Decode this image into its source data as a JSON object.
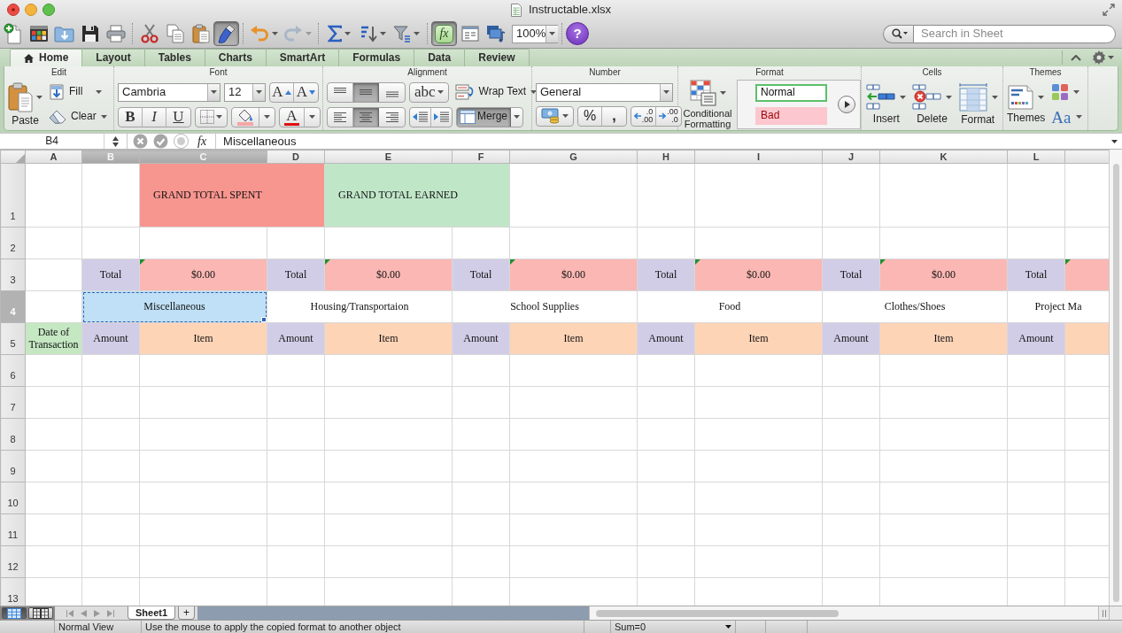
{
  "window": {
    "title": "Instructable.xlsx"
  },
  "toolbar": {
    "redo": {
      "disabled": true
    },
    "format_painter": {
      "pressed": true
    },
    "formula_builder": {
      "label": "fx",
      "pressed": true
    },
    "zoom": "100%",
    "help": "?",
    "search": {
      "placeholder": "Search in Sheet"
    }
  },
  "ribbon": {
    "tabs": [
      {
        "label": "Home",
        "selected": true
      },
      {
        "label": "Layout",
        "selected": false
      },
      {
        "label": "Tables",
        "selected": false
      },
      {
        "label": "Charts",
        "selected": false
      },
      {
        "label": "SmartArt",
        "selected": false
      },
      {
        "label": "Formulas",
        "selected": false
      },
      {
        "label": "Data",
        "selected": false
      },
      {
        "label": "Review",
        "selected": false
      }
    ],
    "edit": {
      "title": "Edit",
      "paste": "Paste",
      "fill": "Fill",
      "clear": "Clear"
    },
    "font": {
      "title": "Font",
      "name": "Cambria",
      "size": "12",
      "grow": "A",
      "shrink": "A",
      "bold": "B",
      "italic": "I",
      "underline": "U",
      "font_color": "A"
    },
    "alignment": {
      "title": "Alignment",
      "vertical": [
        {
          "selected": false
        },
        {
          "selected": true
        },
        {
          "selected": false
        }
      ],
      "orientation": "abc",
      "wrap_text": {
        "label": "Wrap Text",
        "pressed": false
      },
      "horizontal": [
        {
          "selected": false
        },
        {
          "selected": true
        },
        {
          "selected": false
        }
      ],
      "merge": {
        "label": "Merge",
        "pressed": true
      }
    },
    "number": {
      "title": "Number",
      "format": "General",
      "percent": "%",
      "comma": ",",
      "decimals": [
        {
          "top": ".0",
          "bottom": ".00"
        },
        {
          "top": ".00",
          "bottom": ".0"
        }
      ]
    },
    "format": {
      "title": "Format",
      "conditional": "Conditional Formatting",
      "styles": [
        {
          "label": "Normal",
          "kind": "normal",
          "selected": true
        },
        {
          "label": "Bad",
          "kind": "bad",
          "selected": false
        }
      ]
    },
    "cells": {
      "title": "Cells",
      "insert": "Insert",
      "delete": "Delete",
      "format": "Format"
    },
    "themes": {
      "title": "Themes",
      "themes": "Themes",
      "fonts": "Aa"
    }
  },
  "formula_bar": {
    "name_box": "B4",
    "function": "fx",
    "content": "Miscellaneous"
  },
  "grid": {
    "columns": [
      {
        "label": "A",
        "selected": false
      },
      {
        "label": "B",
        "selected": true
      },
      {
        "label": "C",
        "selected": true
      },
      {
        "label": "D",
        "selected": false
      },
      {
        "label": "E",
        "selected": false
      },
      {
        "label": "F",
        "selected": false
      },
      {
        "label": "G",
        "selected": false
      },
      {
        "label": "H",
        "selected": false
      },
      {
        "label": "I",
        "selected": false
      },
      {
        "label": "J",
        "selected": false
      },
      {
        "label": "K",
        "selected": false
      },
      {
        "label": "L",
        "selected": false
      },
      {
        "selected": false
      }
    ],
    "rows": [
      {
        "header": "1",
        "selected": false,
        "cells": [
          {},
          {},
          {
            "text": "GRAND TOTAL SPENT",
            "merged": true,
            "color": "#f7958f"
          },
          {
            "text": "GRAND TOTAL EARNED",
            "merged": true,
            "color": "#c0e6c8"
          },
          {},
          {},
          {},
          {},
          {},
          {},
          {}
        ]
      },
      {
        "header": "2",
        "selected": false
      },
      {
        "header": "3",
        "selected": false,
        "cells": [
          {},
          {
            "text": "Total",
            "color": "#d2cde7"
          },
          {
            "text": "$0.00",
            "color": "#fbb7b3",
            "flagged": true
          },
          {
            "text": "Total",
            "color": "#d2cde7"
          },
          {
            "text": "$0.00",
            "color": "#fbb7b3",
            "flagged": true
          },
          {
            "text": "Total",
            "color": "#d2cde7"
          },
          {
            "text": "$0.00",
            "color": "#fbb7b3",
            "flagged": true
          },
          {
            "text": "Total",
            "color": "#d2cde7"
          },
          {
            "text": "$0.00",
            "color": "#fbb7b3",
            "flagged": true
          },
          {
            "text": "Total",
            "color": "#d2cde7"
          },
          {
            "text": "$0.00",
            "color": "#fbb7b3",
            "flagged": true
          },
          {
            "text": "Total",
            "color": "#d2cde7"
          },
          {
            "color": "#fbb7b3",
            "flagged": true
          }
        ]
      },
      {
        "header": "4",
        "selected": true,
        "cells": [
          {},
          {
            "text": "Miscellaneous",
            "merged": true,
            "color": "#bfe0f6"
          },
          {
            "text": "Housing/Transportaion",
            "merged": true
          },
          {
            "text": "School Supplies",
            "merged": true
          },
          {
            "text": "Food",
            "merged": true
          },
          {
            "text": "Clothes/Shoes",
            "merged": true
          },
          {
            "text": "Project Ma",
            "merged": true
          }
        ]
      },
      {
        "header": "5",
        "selected": false,
        "cells": [
          {
            "text": "Date of Transaction",
            "color": "#c5e8c3"
          },
          {
            "text": "Amount",
            "color": "#d2cde7"
          },
          {
            "text": "Item",
            "color": "#fed4b7"
          },
          {
            "text": "Amount",
            "color": "#d2cde7"
          },
          {
            "text": "Item",
            "color": "#fed4b7"
          },
          {
            "text": "Amount",
            "color": "#d2cde7"
          },
          {
            "text": "Item",
            "color": "#fed4b7"
          },
          {
            "text": "Amount",
            "color": "#d2cde7"
          },
          {
            "text": "Item",
            "color": "#fed4b7"
          },
          {
            "text": "Amount",
            "color": "#d2cde7"
          },
          {
            "text": "Item",
            "color": "#fed4b7"
          },
          {
            "text": "Amount",
            "color": "#d2cde7"
          },
          {
            "color": "#fed4b7"
          }
        ]
      },
      {
        "header": "6",
        "selected": false
      },
      {
        "header": "7",
        "selected": false
      },
      {
        "header": "8",
        "selected": false
      },
      {
        "header": "9",
        "selected": false
      },
      {
        "header": "10",
        "selected": false
      },
      {
        "header": "11",
        "selected": false
      },
      {
        "header": "12",
        "selected": false
      },
      {
        "header": "13",
        "selected": false
      }
    ]
  },
  "sheet_bar": {
    "views": [
      {
        "selected": true
      },
      {
        "selected": false
      }
    ],
    "tabs": [
      {
        "label": "Sheet1",
        "selected": true
      }
    ],
    "add": "+"
  },
  "status_bar": {
    "view": "Normal View",
    "message": "Use the mouse to apply the copied format to another object",
    "sum": "Sum=0"
  }
}
